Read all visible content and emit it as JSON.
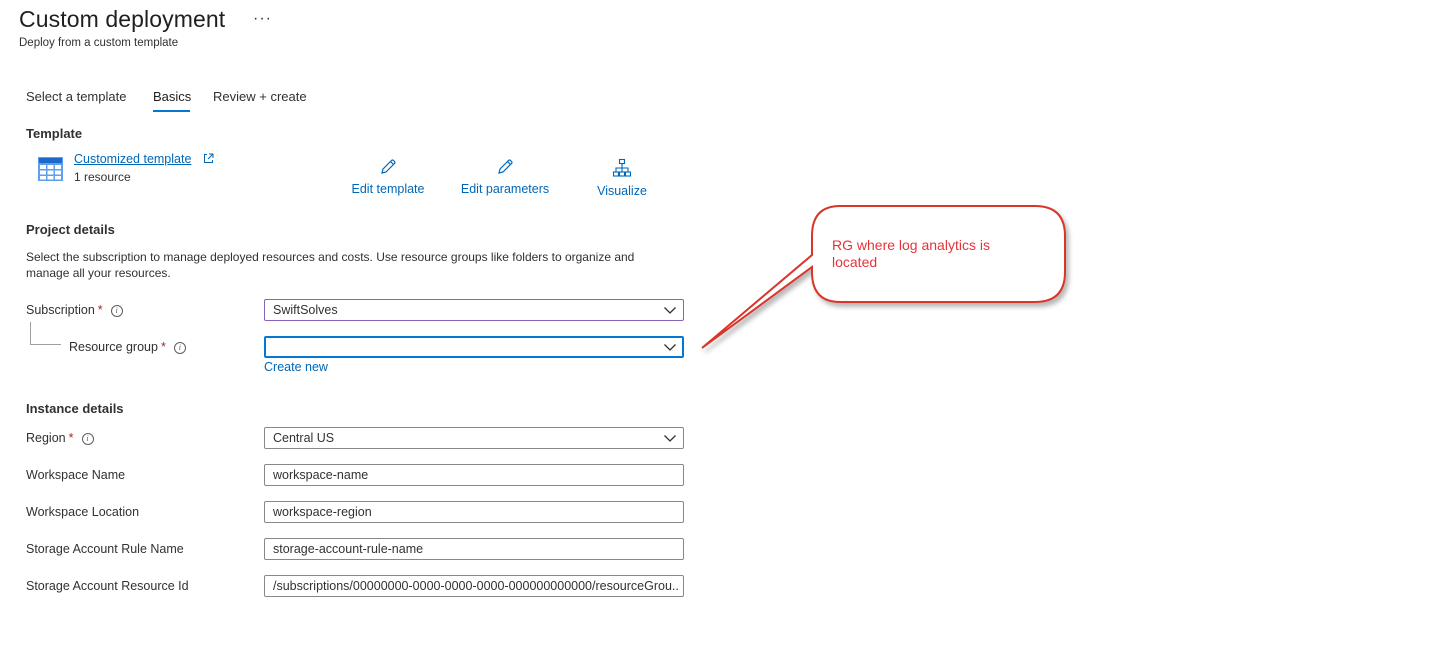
{
  "header": {
    "title": "Custom deployment",
    "more": "···",
    "subtitle": "Deploy from a custom template"
  },
  "tabs": [
    {
      "label": "Select a template",
      "active": false
    },
    {
      "label": "Basics",
      "active": true
    },
    {
      "label": "Review + create",
      "active": false
    }
  ],
  "template_section": {
    "heading": "Template",
    "link": "Customized template",
    "count": "1 resource",
    "actions": {
      "edit_template": "Edit template",
      "edit_parameters": "Edit parameters",
      "visualize": "Visualize"
    }
  },
  "project_details": {
    "heading": "Project details",
    "description": "Select the subscription to manage deployed resources and costs. Use resource groups like folders to organize and manage all your resources.",
    "subscription": {
      "label": "Subscription",
      "required": "*",
      "value": "SwiftSolves"
    },
    "resource_group": {
      "label": "Resource group",
      "required": "*",
      "value": "",
      "create_new": "Create new"
    }
  },
  "instance_details": {
    "heading": "Instance details",
    "region": {
      "label": "Region",
      "required": "*",
      "value": "Central US"
    },
    "workspace_name": {
      "label": "Workspace Name",
      "value": "workspace-name"
    },
    "workspace_location": {
      "label": "Workspace Location",
      "value": "workspace-region"
    },
    "storage_rule_name": {
      "label": "Storage Account Rule Name",
      "value": "storage-account-rule-name"
    },
    "storage_resource_id": {
      "label": "Storage Account Resource Id",
      "value": "/subscriptions/00000000-0000-0000-0000-000000000000/resourceGrou..."
    }
  },
  "annotation": {
    "text": "RG where log analytics is located",
    "text_color": "#e5333a",
    "border_color": "#d9342b"
  },
  "colors": {
    "accent": "#0078d4",
    "link": "#0067b8",
    "required": "#a4262c",
    "subscription_border": "#8764b8"
  },
  "icons": {
    "more": "ellipsis-icon",
    "template": "template-grid-icon",
    "external": "external-link-icon",
    "edit": "pencil-icon",
    "visualize": "hierarchy-icon",
    "info": "info-icon",
    "dropdown": "chevron-down-icon"
  }
}
